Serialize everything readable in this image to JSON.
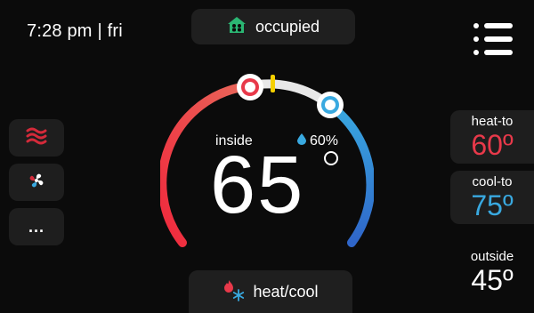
{
  "header": {
    "time": "7:28 pm",
    "day": "fri",
    "separator": "|",
    "status": "occupied",
    "status_icon": "occupied-home-icon",
    "menu_icon": "menu-icon"
  },
  "sidebar": {
    "items": [
      {
        "name": "heat-waves-icon",
        "color": "#d42a3a"
      },
      {
        "name": "fan-icon",
        "color": "#ffffff"
      },
      {
        "name": "more-icon",
        "label": "..."
      }
    ]
  },
  "dial": {
    "inside_label": "inside",
    "humidity": "60%",
    "temperature": "65",
    "heat_setpoint": 60,
    "cool_setpoint": 75,
    "heat_color": "#e8394a",
    "cool_color": "#39a9e0",
    "indicator_color": "#f5d000"
  },
  "mode": {
    "label": "heat/cool",
    "icon": "heat-cool-icon"
  },
  "setpoints": {
    "heat_label": "heat-to",
    "heat_value": "60º",
    "heat_color": "#e8394a",
    "cool_label": "cool-to",
    "cool_value": "75º",
    "cool_color": "#39a9e0"
  },
  "outside": {
    "label": "outside",
    "value": "45º"
  }
}
